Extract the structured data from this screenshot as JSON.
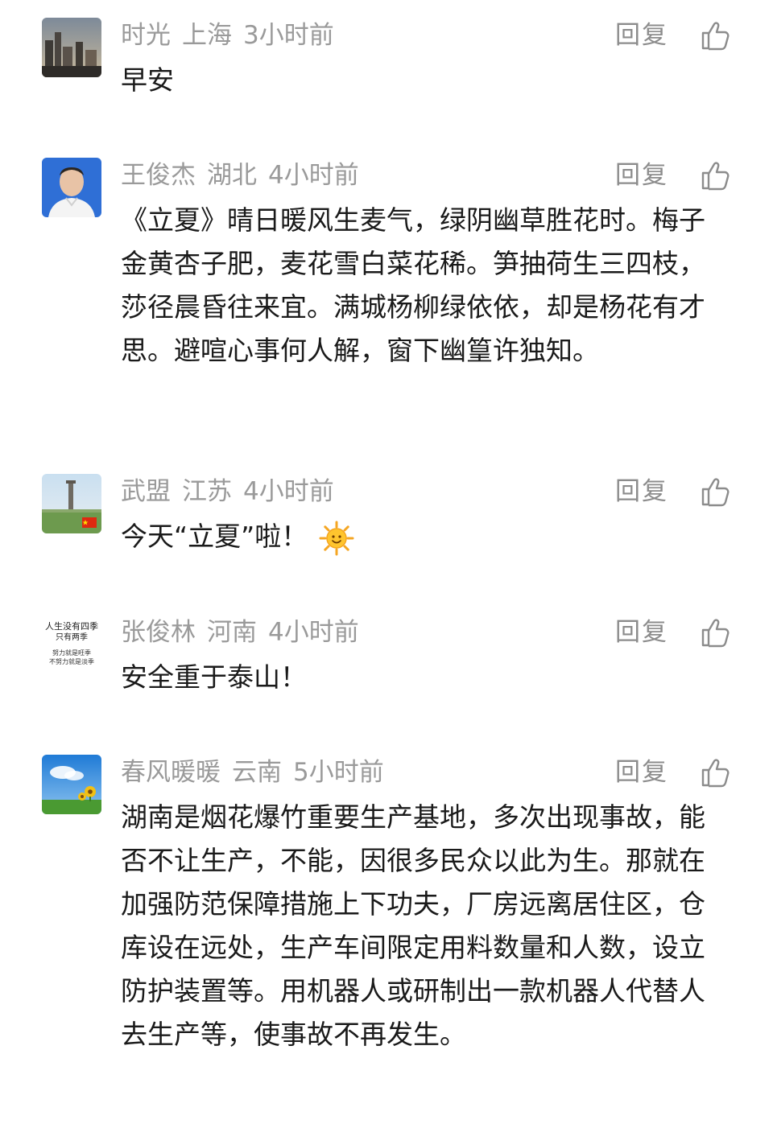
{
  "reply_label": "回复",
  "comments": [
    {
      "name": "时光",
      "location": "上海",
      "time": "3小时前",
      "text": "早安"
    },
    {
      "name": "王俊杰",
      "location": "湖北",
      "time": "4小时前",
      "text": "《立夏》晴日暖风生麦气，绿阴幽草胜花时。梅子金黄杏子肥，麦花雪白菜花稀。笋抽荷生三四枝，莎径晨昏往来宜。满城杨柳绿依依，却是杨花有才思。避喧心事何人解，窗下幽篁许独知。"
    },
    {
      "name": "武盟",
      "location": "江苏",
      "time": "4小时前",
      "text": "今天“立夏”啦！"
    },
    {
      "name": "张俊林",
      "location": "河南",
      "time": "4小时前",
      "text": "安全重于泰山！",
      "avatar_text": [
        "人生没有四季",
        "只有两季",
        "努力就是旺季",
        "不努力就是淡季"
      ]
    },
    {
      "name": "春风暖暖",
      "location": "云南",
      "time": "5小时前",
      "text": "湖南是烟花爆竹重要生产基地，多次出现事故，能否不让生产，不能，因很多民众以此为生。那就在加强防范保障措施上下功夫，厂房远离居住区，仓库设在远处，生产车间限定用料数量和人数，设立防护装置等。用机器人或研制出一款机器人代替人去生产等，使事故不再发生。"
    }
  ]
}
